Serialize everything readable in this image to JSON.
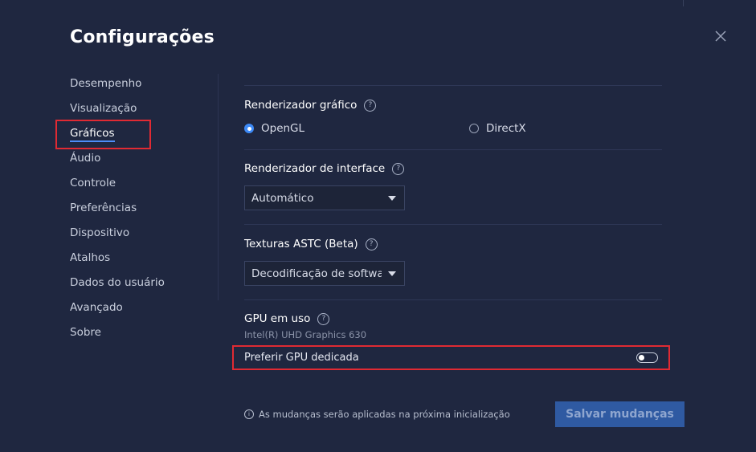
{
  "dialog": {
    "title": "Configurações",
    "close_icon": "close-icon"
  },
  "sidebar": {
    "items": [
      {
        "label": "Desempenho"
      },
      {
        "label": "Visualização"
      },
      {
        "label": "Gráficos",
        "active": true
      },
      {
        "label": "Áudio"
      },
      {
        "label": "Controle"
      },
      {
        "label": "Preferências"
      },
      {
        "label": "Dispositivo"
      },
      {
        "label": "Atalhos"
      },
      {
        "label": "Dados do usuário"
      },
      {
        "label": "Avançado"
      },
      {
        "label": "Sobre"
      }
    ]
  },
  "graphics": {
    "renderer": {
      "label": "Renderizador gráfico",
      "options": [
        {
          "label": "OpenGL",
          "selected": true
        },
        {
          "label": "DirectX",
          "selected": false
        }
      ]
    },
    "interface_renderer": {
      "label": "Renderizador de interface",
      "value": "Automático"
    },
    "astc": {
      "label": "Texturas ASTC (Beta)",
      "value": "Decodificação de software"
    },
    "gpu": {
      "label": "GPU em uso",
      "name": "Intel(R) UHD Graphics 630",
      "prefer_dedicated_label": "Preferir GPU dedicada",
      "prefer_dedicated_on": false
    }
  },
  "footer": {
    "note": "As mudanças serão aplicadas na próxima inicialização",
    "save_label": "Salvar mudanças"
  },
  "colors": {
    "background": "#1f2740",
    "accent": "#3d8af7",
    "highlight_border": "#e02a33",
    "save_button": "#2f5aa2"
  }
}
